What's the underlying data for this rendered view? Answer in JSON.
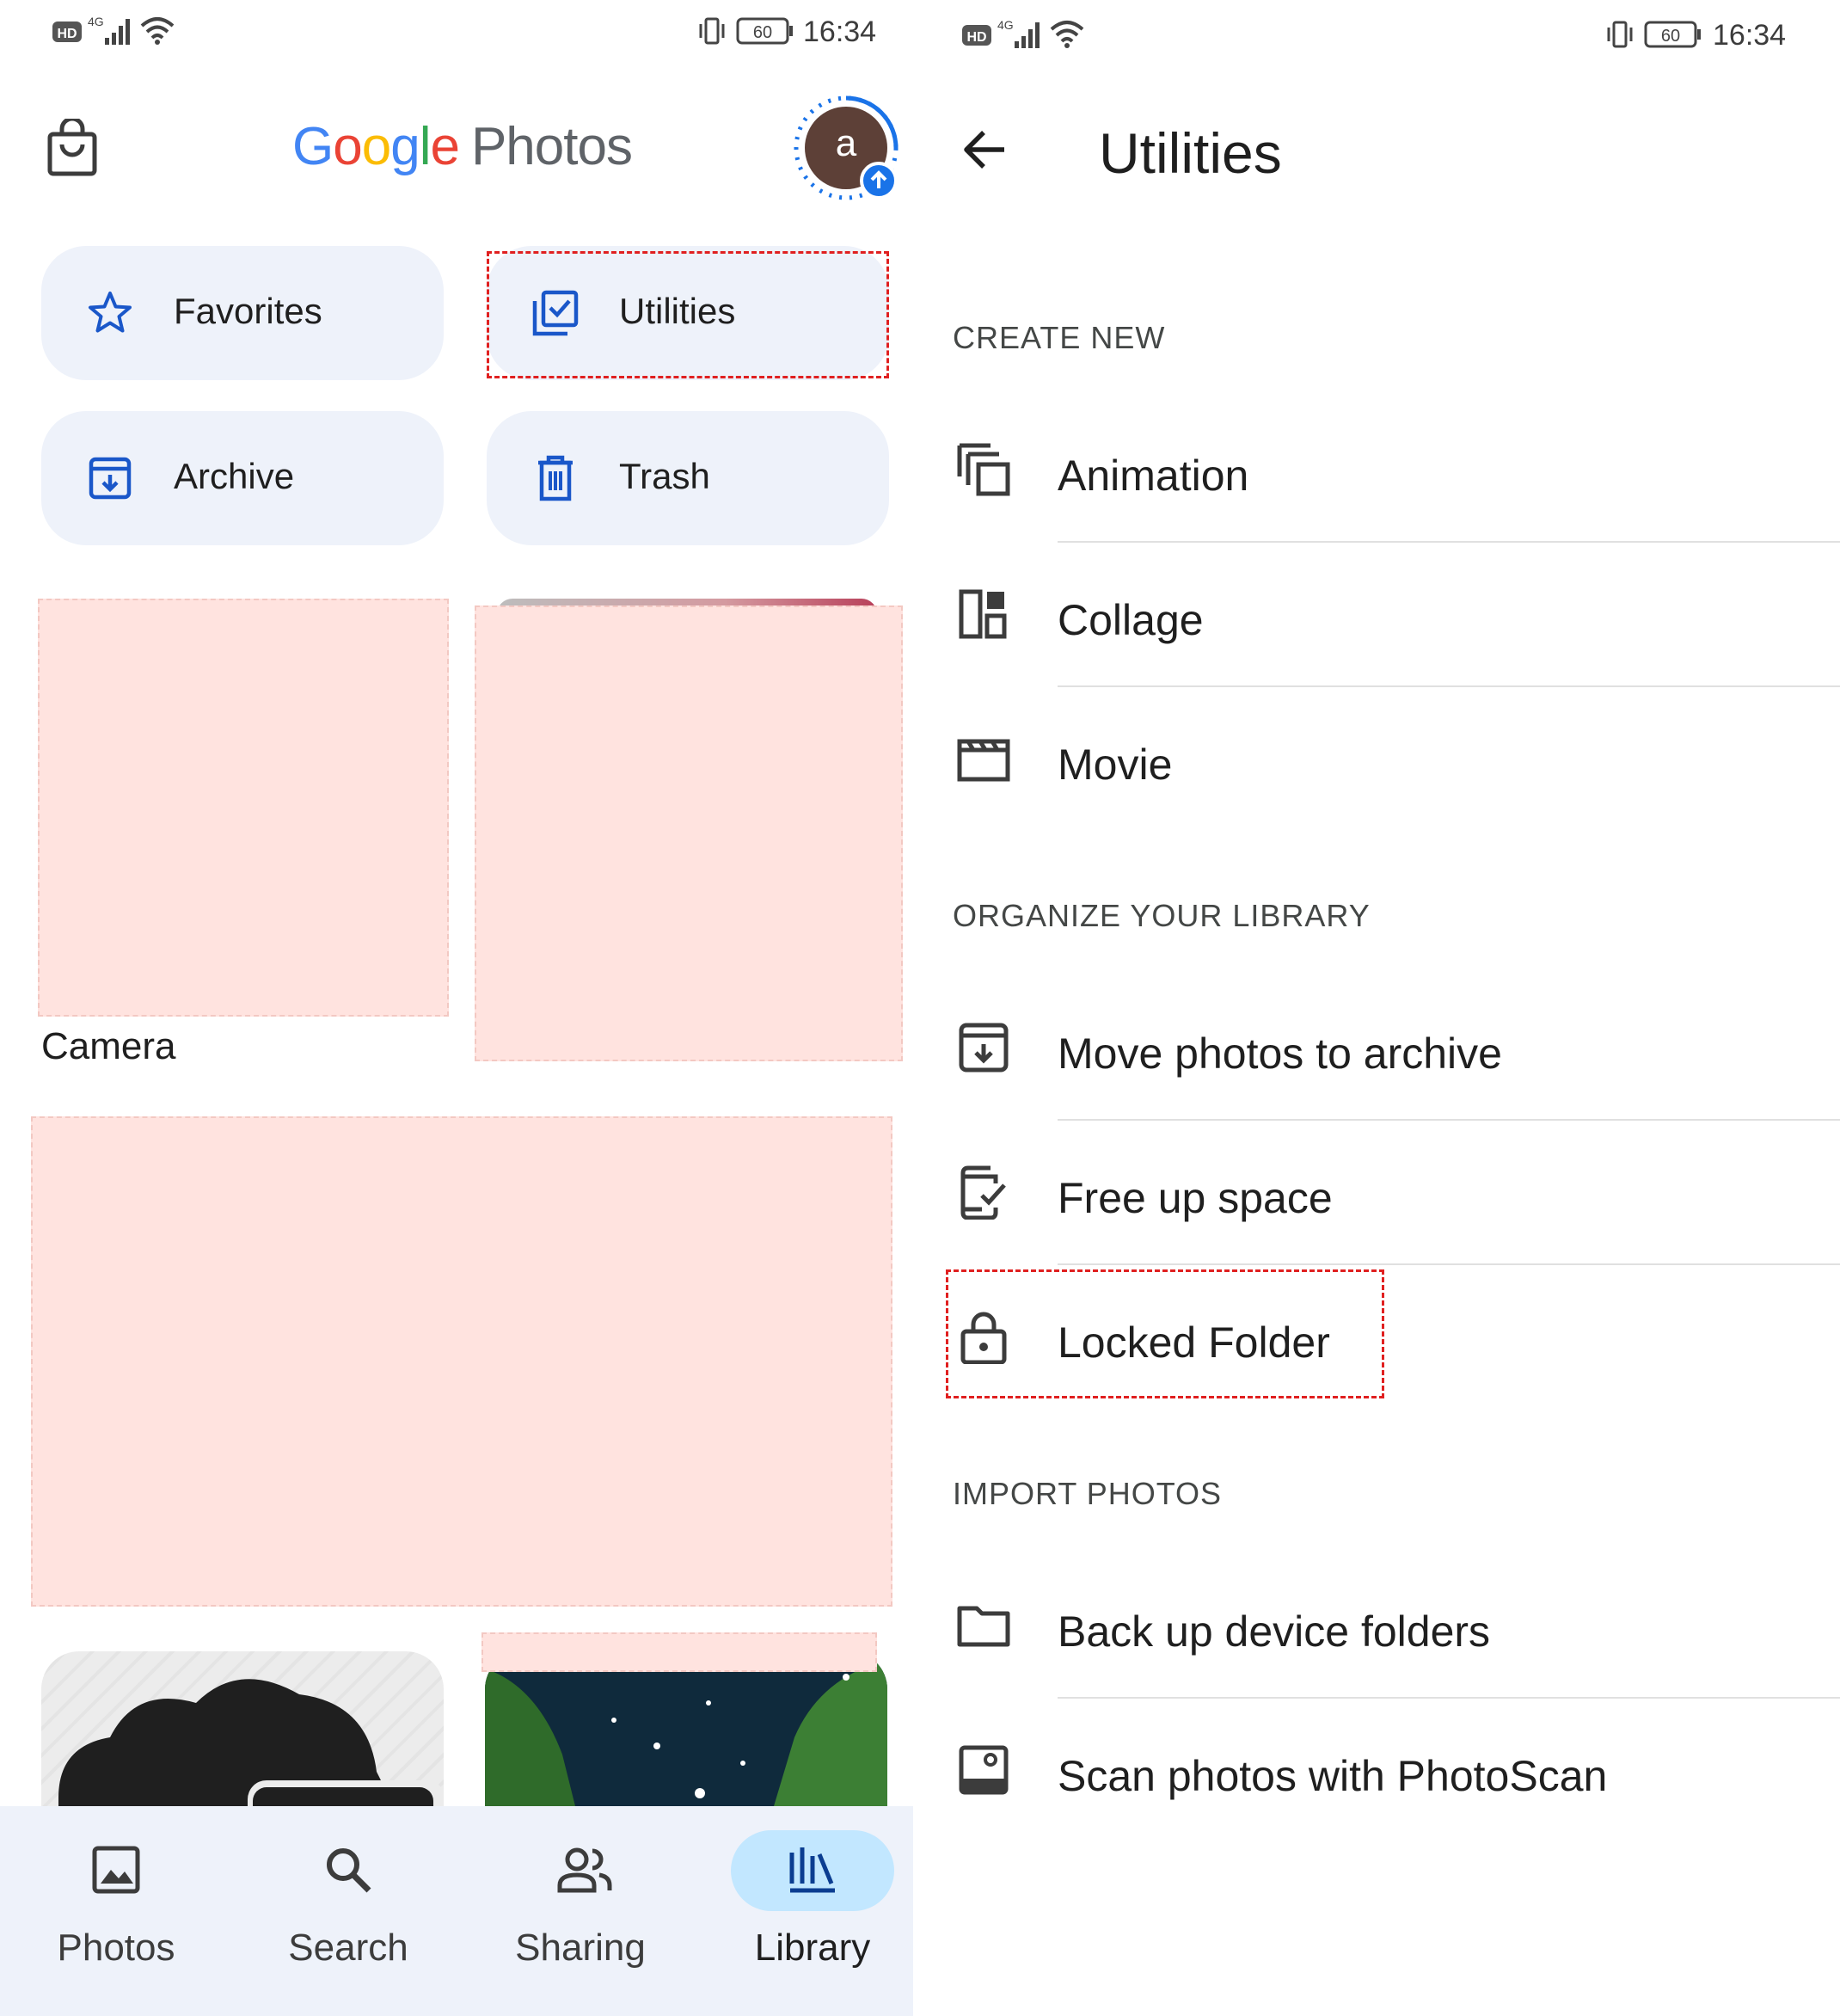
{
  "left": {
    "status": {
      "time": "16:34",
      "battery": "60",
      "network": "4G",
      "hd": "HD"
    },
    "header": {
      "logo_google": [
        "G",
        "o",
        "o",
        "g",
        "l",
        "e"
      ],
      "logo_product": "Photos",
      "avatar_letter": "a"
    },
    "tiles": [
      {
        "label": "Favorites",
        "icon": "star-icon"
      },
      {
        "label": "Utilities",
        "icon": "utilities-icon"
      },
      {
        "label": "Archive",
        "icon": "archive-icon"
      },
      {
        "label": "Trash",
        "icon": "trash-icon"
      }
    ],
    "albums": {
      "camera_label": "Camera"
    },
    "bottom_nav": [
      {
        "label": "Photos",
        "icon": "photo-icon",
        "active": false
      },
      {
        "label": "Search",
        "icon": "search-icon",
        "active": false
      },
      {
        "label": "Sharing",
        "icon": "people-icon",
        "active": false
      },
      {
        "label": "Library",
        "icon": "library-icon",
        "active": true
      }
    ]
  },
  "right": {
    "status": {
      "time": "16:34",
      "battery": "60",
      "network": "4G",
      "hd": "HD"
    },
    "title": "Utilities",
    "sections": [
      {
        "header": "CREATE NEW",
        "items": [
          {
            "label": "Animation",
            "icon": "animation-icon"
          },
          {
            "label": "Collage",
            "icon": "collage-icon"
          },
          {
            "label": "Movie",
            "icon": "movie-icon"
          }
        ]
      },
      {
        "header": "ORGANIZE YOUR LIBRARY",
        "items": [
          {
            "label": "Move photos to archive",
            "icon": "archive-icon"
          },
          {
            "label": "Free up space",
            "icon": "free-up-space-icon"
          },
          {
            "label": "Locked Folder",
            "icon": "lock-icon"
          }
        ]
      },
      {
        "header": "IMPORT PHOTOS",
        "items": [
          {
            "label": "Back up device folders",
            "icon": "folder-icon"
          },
          {
            "label": "Scan photos with PhotoScan",
            "icon": "photoscan-icon"
          }
        ]
      }
    ]
  },
  "colors": {
    "accent": "#1a57c9",
    "tile_bg": "#eef2fa",
    "nav_active": "#c2e7ff",
    "highlight": "#e02020"
  }
}
